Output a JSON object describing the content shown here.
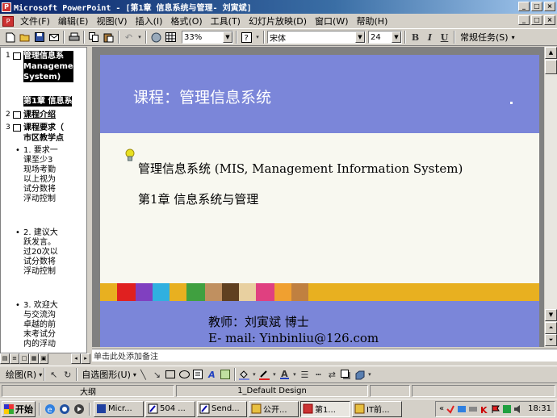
{
  "window": {
    "title": "Microsoft PowerPoint - [第1章 信息系统与管理- 刘寅斌]",
    "controls": [
      "_",
      "□",
      "×"
    ]
  },
  "menubar": {
    "items": [
      "文件(F)",
      "编辑(E)",
      "视图(V)",
      "插入(I)",
      "格式(O)",
      "工具(T)",
      "幻灯片放映(D)",
      "窗口(W)",
      "帮助(H)"
    ]
  },
  "toolbar": {
    "zoom": "33%",
    "font_name": "宋体",
    "font_size": "24",
    "bold": "B",
    "italic": "I",
    "underline": "U",
    "tasks": "常规任务(S)"
  },
  "outline": {
    "slides": [
      {
        "num": "1",
        "lines": [
          "管理信息系",
          "Manageme",
          "System)"
        ]
      },
      {
        "num": "",
        "lines": [
          "第1章 信息系"
        ]
      },
      {
        "num": "2",
        "lines": [
          "课程介绍"
        ]
      },
      {
        "num": "3",
        "lines": [
          "课程要求（",
          "市区教学点"
        ]
      }
    ],
    "bullets": [
      [
        "1. 要求一",
        "课至少3",
        "现场考勤",
        "以上视为",
        "试分数将",
        "浮动控制"
      ],
      [
        "2. 建议大",
        "跃发言。",
        "过20次以",
        "试分数将",
        "浮动控制"
      ],
      [
        "3. 欢迎大",
        "与交流沟",
        "卓越的前",
        "末考试分",
        "内的浮动"
      ]
    ]
  },
  "slide": {
    "title": "课程：管理信息系统",
    "line1": "管理信息系统 (MIS, Management Information System)",
    "line2": "第1章  信息系统与管理",
    "teacher": "教师：刘寅斌 博士",
    "email": "E- mail: Yinbinliu@126.com"
  },
  "notes": {
    "placeholder": "单击此处添加备注"
  },
  "drawbar": {
    "draw": "绘图(R)",
    "autoshapes": "自选图形(U)"
  },
  "statusbar": {
    "view": "大纲",
    "design": "1_Default Design"
  },
  "taskbar": {
    "start": "开始",
    "tasks": [
      "Micr...",
      "504 ...",
      "Send...",
      "公开...",
      "第1...",
      "IT前..."
    ],
    "tray_chevron": "«",
    "clock": "18:31"
  },
  "colors": {
    "titlebar": "#0a246a",
    "slide_header": "#7b86d9",
    "slide_stripe": "#e8b020",
    "desktop": "#d4d0c8"
  }
}
